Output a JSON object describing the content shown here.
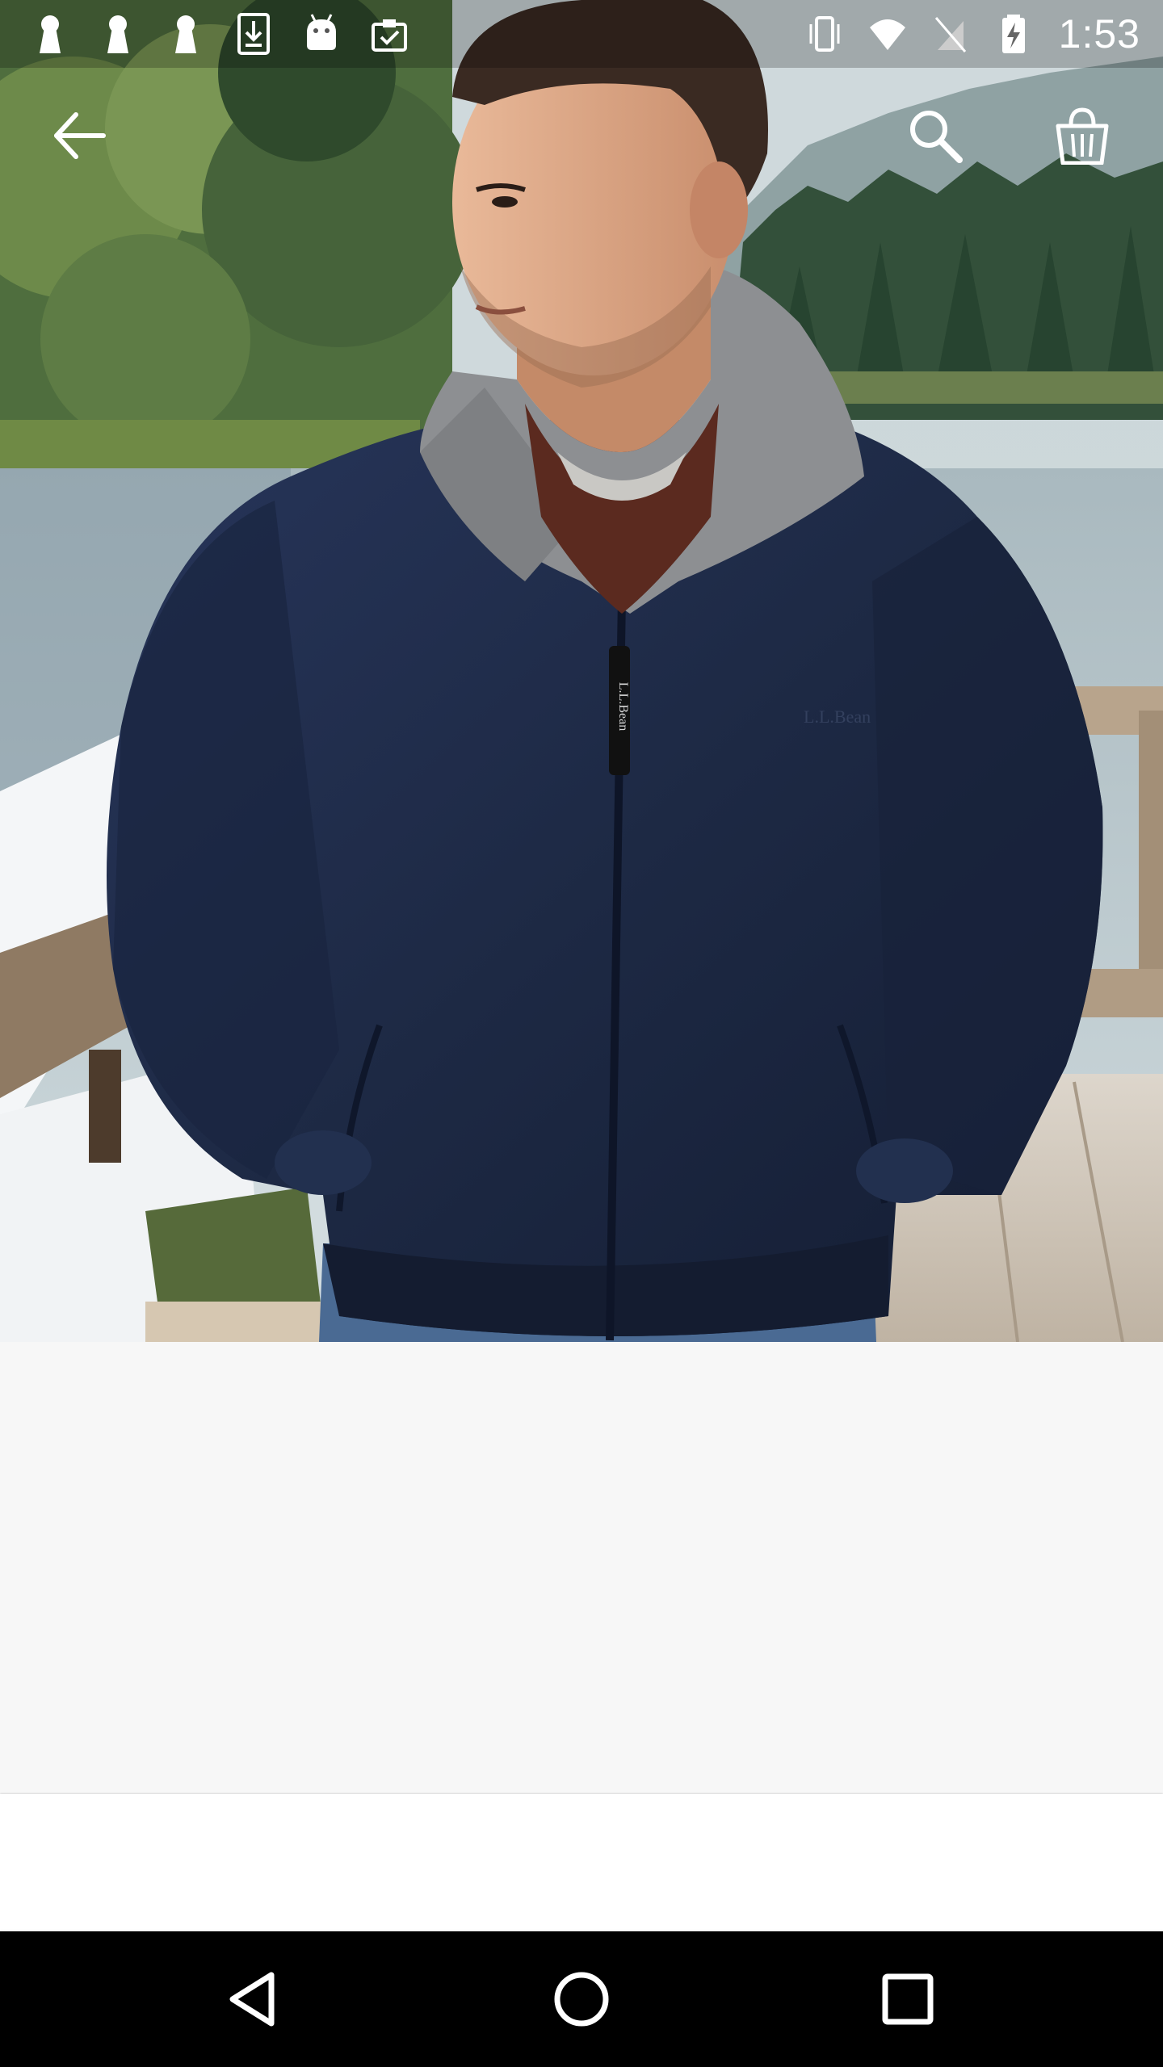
{
  "status_bar": {
    "time": "1:53",
    "left_icons": [
      "keyhole-icon",
      "keyhole-icon",
      "keyhole-icon",
      "download-icon",
      "android-icon",
      "clipboard-check-icon"
    ],
    "right_icons": [
      "vibrate-icon",
      "wifi-icon",
      "no-sim-icon",
      "battery-charging-icon"
    ]
  },
  "app_bar": {
    "icons": [
      "back-arrow-icon",
      "search-icon",
      "shopping-bag-icon"
    ]
  },
  "product_image": {
    "zipper_pull_text": "L.L.Bean",
    "chest_logo_text": "L.L.Bean"
  },
  "nav_bar": {
    "icons": [
      "nav-back-icon",
      "nav-home-icon",
      "nav-recents-icon"
    ]
  },
  "colors": {
    "jacket": "#1f2b45",
    "collar_fleece": "#8d8f92",
    "background": "#f7f7f7",
    "nav_bar": "#000000"
  }
}
